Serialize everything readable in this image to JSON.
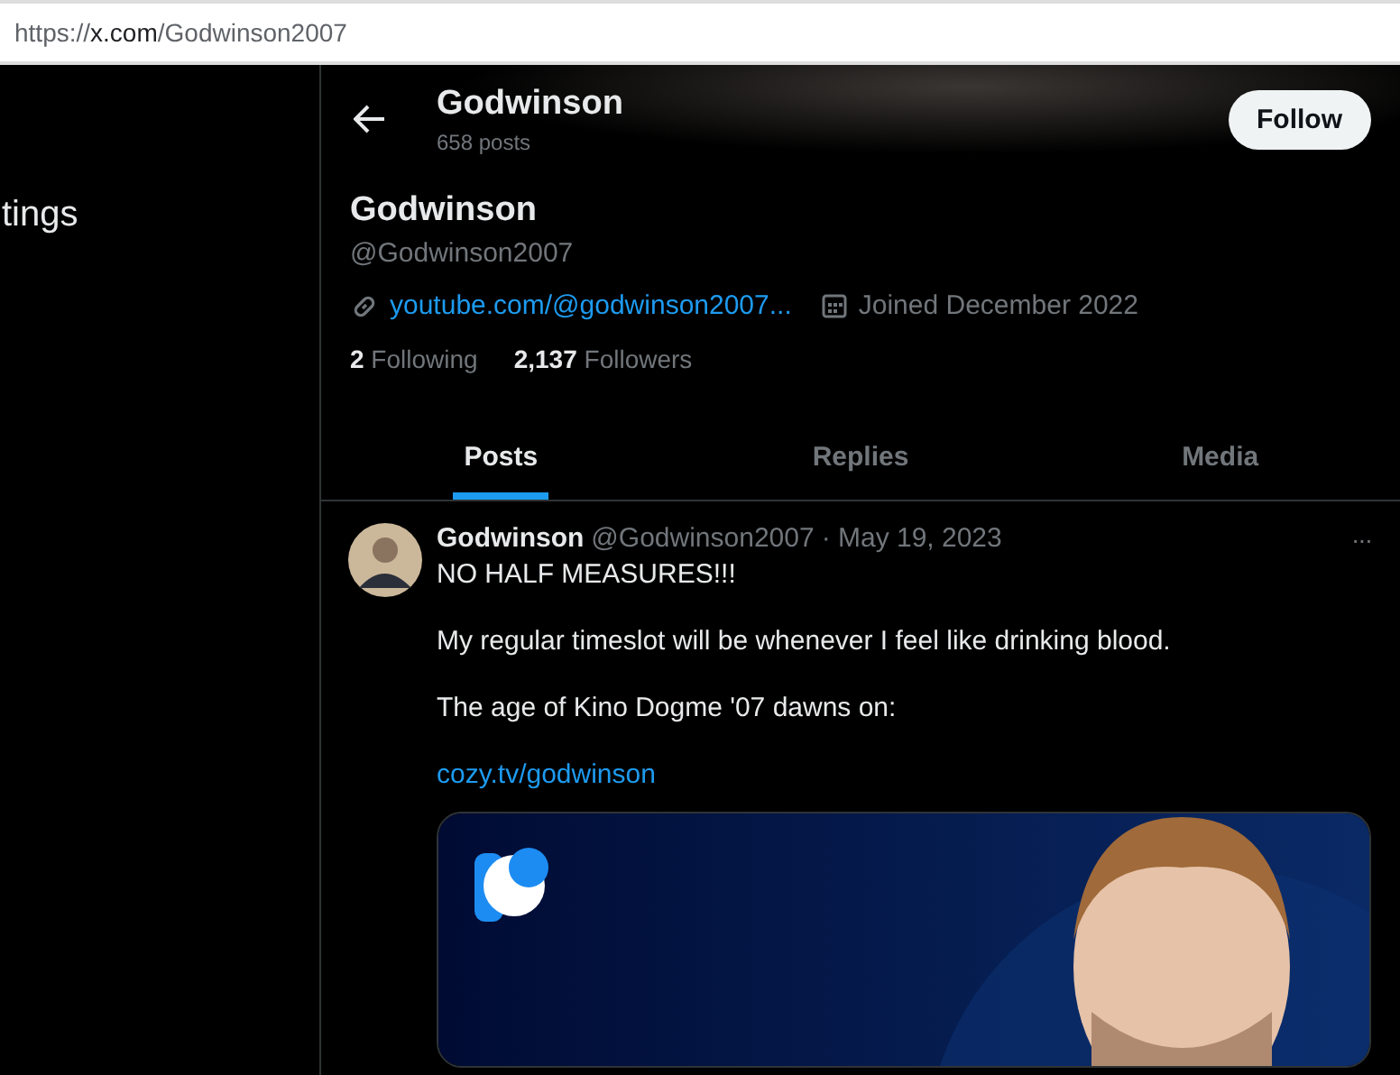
{
  "address_bar": {
    "scheme": "https://",
    "host": "x.com",
    "path": "/Godwinson2007"
  },
  "sidebar": {
    "items": [
      "tings"
    ]
  },
  "header": {
    "name": "Godwinson",
    "posts": "658 posts",
    "follow_button": "Follow"
  },
  "profile": {
    "name": "Godwinson",
    "handle": "@Godwinson2007",
    "link": "youtube.com/@godwinson2007...",
    "joined": "Joined December 2022",
    "stats": [
      {
        "count": "2",
        "label": "Following"
      },
      {
        "count": "2,137",
        "label": "Followers"
      }
    ]
  },
  "tabs": [
    {
      "label": "Posts",
      "selected": true
    },
    {
      "label": "Replies",
      "selected": false
    },
    {
      "label": "Media",
      "selected": false
    }
  ],
  "post": {
    "author": "Godwinson",
    "handle": "@Godwinson2007",
    "date": "· May 19, 2023",
    "more": "···",
    "paragraphs": [
      {
        "kind": "text",
        "text": "NO HALF MEASURES!!!"
      },
      {
        "kind": "text",
        "text": "My regular timeslot will be whenever I feel like drinking blood."
      },
      {
        "kind": "text",
        "text": "The age of Kino Dogme '07 dawns on:"
      },
      {
        "kind": "link",
        "text": "cozy.tv/godwinson"
      }
    ]
  }
}
